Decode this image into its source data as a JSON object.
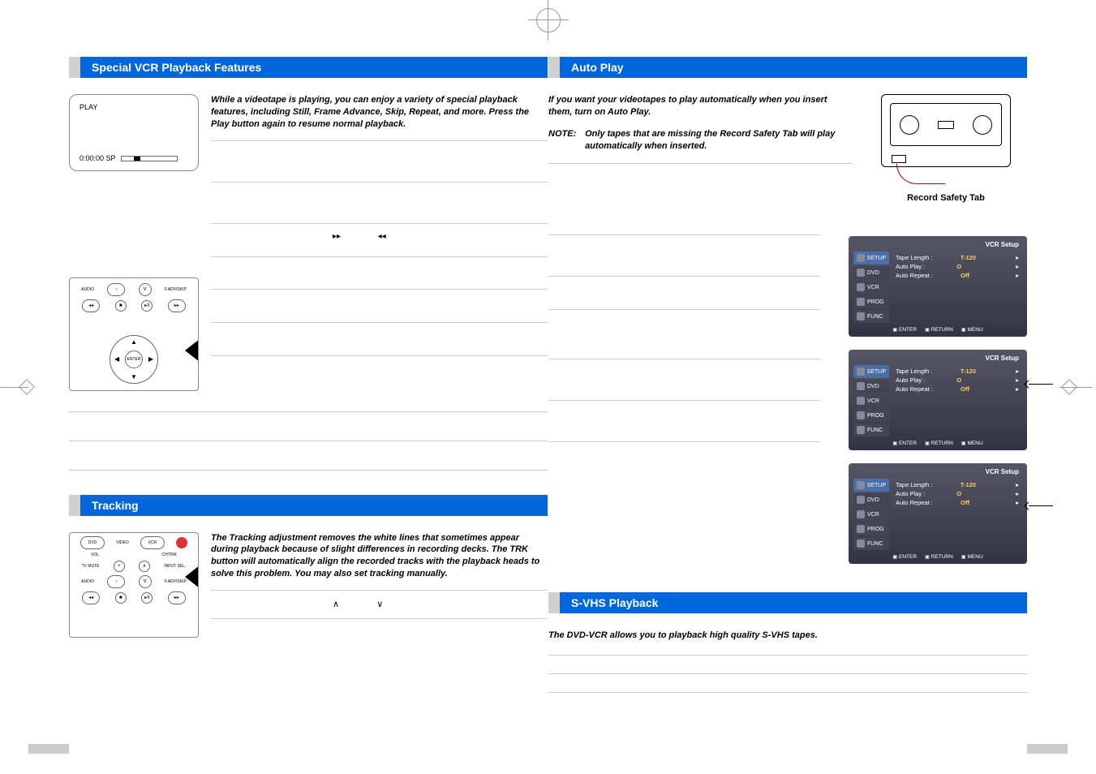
{
  "leftPage": {
    "section1": {
      "title": "Special VCR Playback Features",
      "intro": "While a videotape is playing, you can enjoy a variety of special playback features, including Still, Frame Advance, Skip, Repeat, and more. Press the Play button again to resume normal playback.",
      "display": {
        "status": "PLAY",
        "counter": "0:00:00 SP"
      },
      "symFwd": "▸▸",
      "symRew": "◂◂"
    },
    "section2": {
      "title": "Tracking",
      "intro": "The Tracking adjustment removes the white lines that sometimes appear during playback because of slight differences in recording decks. The TRK button will automatically align the recorded tracks with the playback heads to solve this problem. You may also set tracking manually.",
      "symUp": "∧",
      "symDown": "∨"
    }
  },
  "rightPage": {
    "section1": {
      "title": "Auto Play",
      "intro": "If you want your videotapes to play automatically when you insert them, turn on Auto Play.",
      "noteLabel": "NOTE:",
      "noteBody": "Only tapes that are missing the Record Safety Tab will play automatically when inserted.",
      "safetyLabel": "Record Safety Tab"
    },
    "osd": {
      "title": "VCR Setup",
      "sidebar": [
        "SETUP",
        "DVD",
        "VCR",
        "PROG",
        "FUNC"
      ],
      "rows": [
        {
          "label": "Tape Length :",
          "value": "T-120"
        },
        {
          "label": "Auto Play :",
          "value": "O"
        },
        {
          "label": "Auto Repeat :",
          "value": "Off"
        }
      ],
      "footer": [
        "ENTER",
        "RETURN",
        "MENU"
      ]
    },
    "section2": {
      "title": "S-VHS Playback",
      "intro": "The DVD-VCR allows you to playback high quality S-VHS tapes."
    }
  },
  "remoteLabels": {
    "audio": "AUDIO",
    "fadv": "F.ADV/SKIP",
    "enter": "ENTER",
    "dvd": "DVD",
    "vcr": "VCR",
    "vol": "VOL",
    "chtrk": "CH/TRK",
    "tvmute": "TV MUTE",
    "inputsel": "INPUT SEL."
  }
}
